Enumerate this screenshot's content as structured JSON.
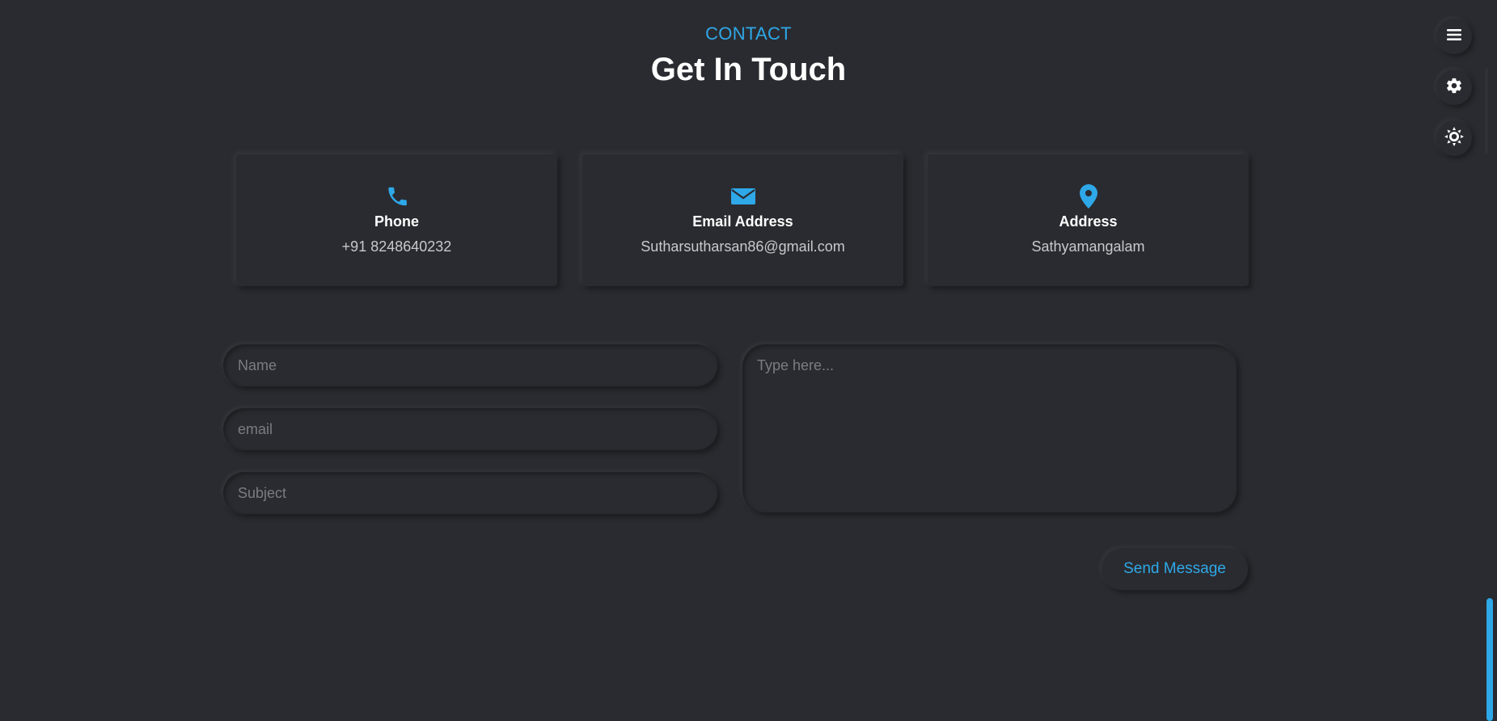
{
  "header": {
    "eyebrow": "CONTACT",
    "title": "Get In Touch"
  },
  "cards": [
    {
      "icon": "phone-icon",
      "title": "Phone",
      "value": "+91 8248640232"
    },
    {
      "icon": "envelope-icon",
      "title": "Email Address",
      "value": "Sutharsutharsan86@gmail.com"
    },
    {
      "icon": "map-pin-icon",
      "title": "Address",
      "value": "Sathyamangalam"
    }
  ],
  "form": {
    "name_placeholder": "Name",
    "email_placeholder": "email",
    "subject_placeholder": "Subject",
    "message_placeholder": "Type here...",
    "send_label": "Send Message"
  },
  "controls": {
    "menu_icon": "hamburger-menu-icon",
    "settings_icon": "gear-icon",
    "theme_icon": "sun-icon"
  },
  "colors": {
    "background": "#2a2b30",
    "accent": "#2ea8e8",
    "text": "#ffffff",
    "muted_text": "#c8c9cc"
  }
}
